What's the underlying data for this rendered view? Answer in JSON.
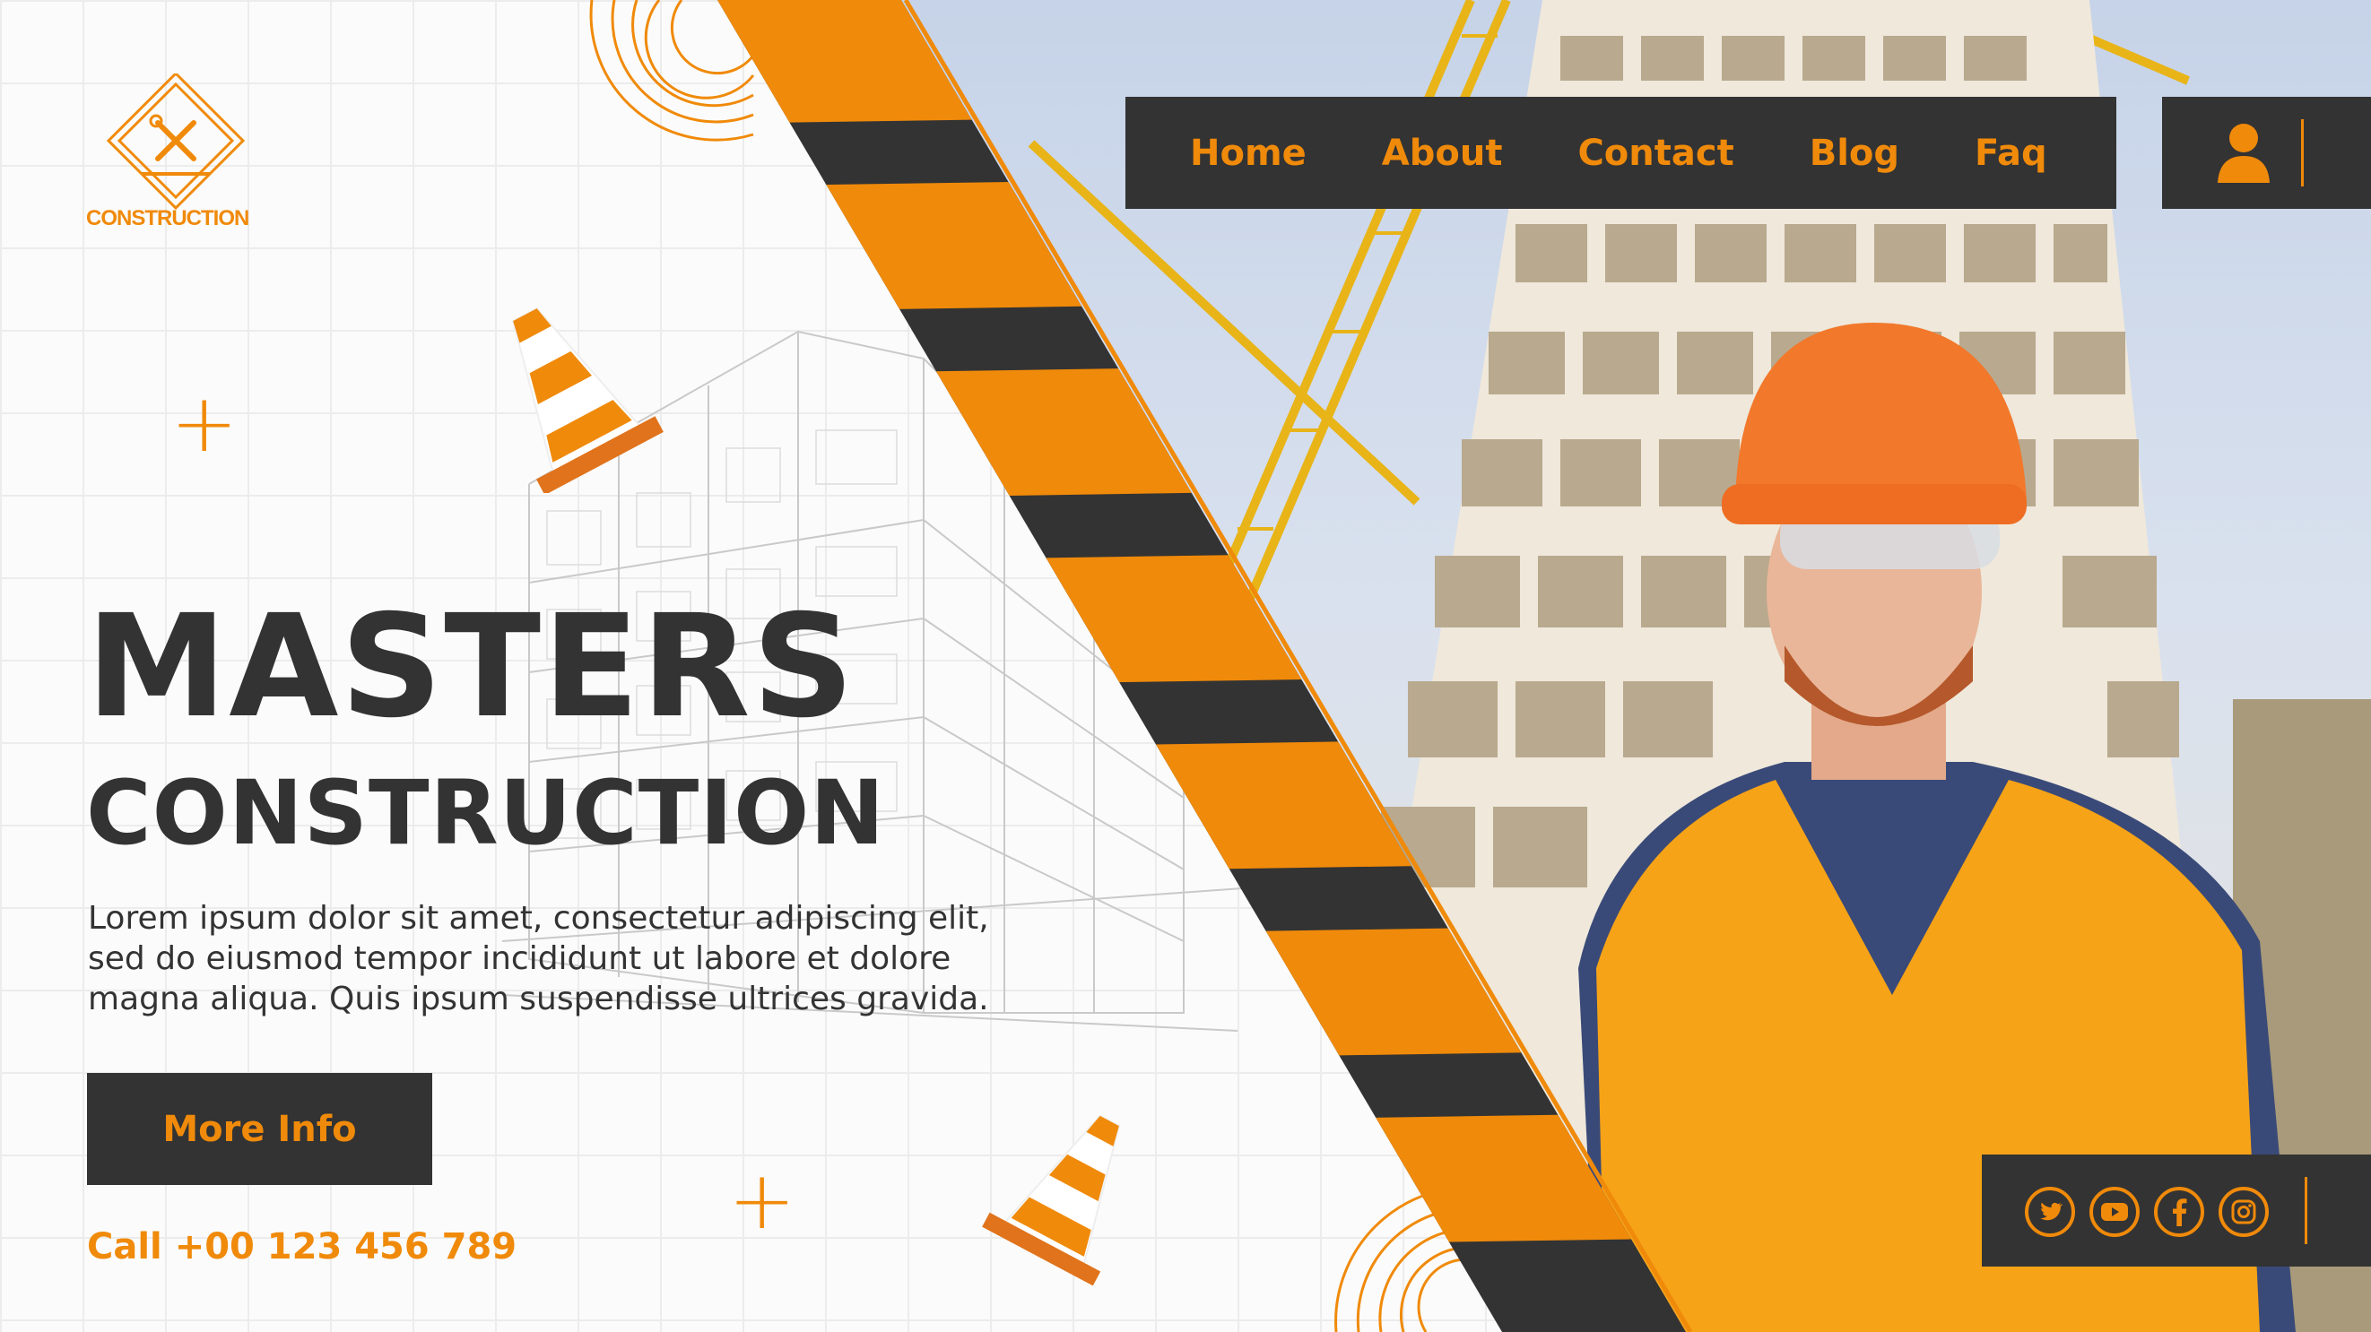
{
  "brand": {
    "logo_text": "CONSTRUCTION"
  },
  "nav": {
    "items": [
      {
        "label": "Home"
      },
      {
        "label": "About"
      },
      {
        "label": "Contact"
      },
      {
        "label": "Blog"
      },
      {
        "label": "Faq"
      }
    ],
    "user_icon": "user-icon"
  },
  "hero": {
    "title_line1": "MASTERS",
    "title_line2": "CONSTRUCTION",
    "body_line1": "Lorem ipsum dolor sit amet, consectetur adipiscing elit,",
    "body_line2": "sed do eiusmod tempor incididunt ut labore et dolore",
    "body_line3": "magna aliqua. Quis ipsum suspendisse ultrices gravida.",
    "cta_label": "More Info",
    "phone": "Call +00 123 456 789"
  },
  "social": {
    "icons": [
      "twitter-icon",
      "youtube-icon",
      "facebook-icon",
      "instagram-icon"
    ]
  },
  "colors": {
    "accent": "#f08a0a",
    "dark": "#333333",
    "background": "#fbfbfb"
  }
}
